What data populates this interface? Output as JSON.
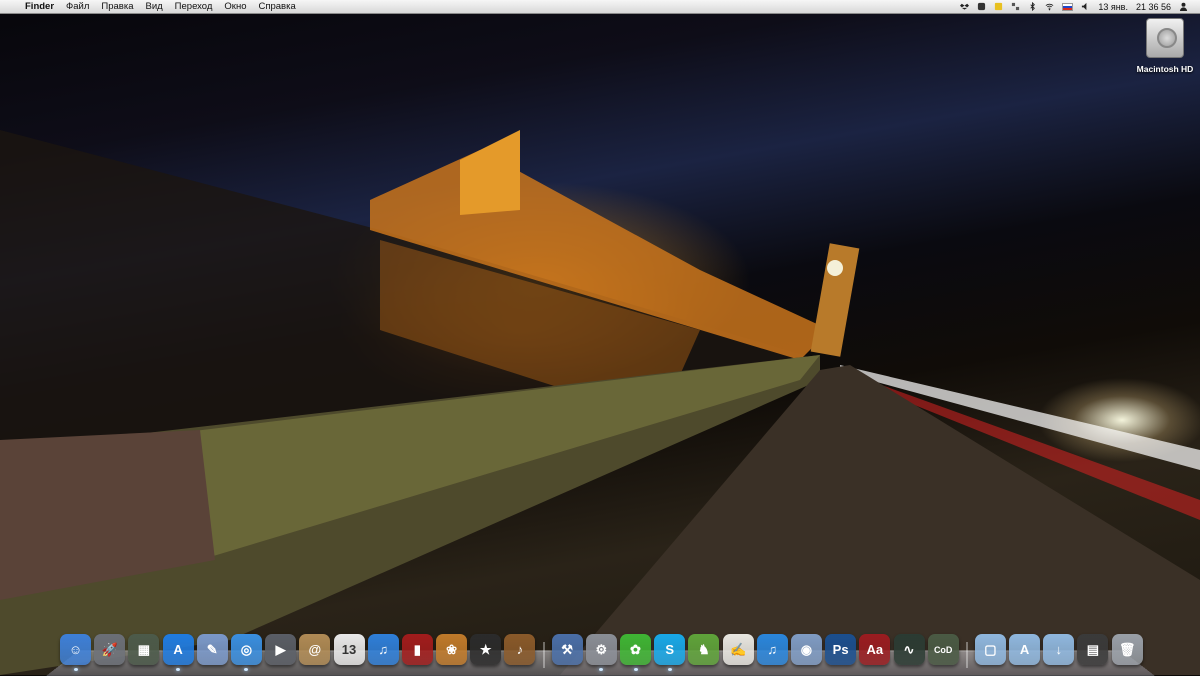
{
  "menubar": {
    "apple_symbol": "",
    "app_name": "Finder",
    "menus": [
      "Файл",
      "Правка",
      "Вид",
      "Переход",
      "Окно",
      "Справка"
    ],
    "status_icons": [
      "dropbox-icon",
      "cloud-icon",
      "note-icon",
      "grid-icon",
      "bluetooth-icon",
      "wifi-icon",
      "flag-ru-icon",
      "volume-icon"
    ],
    "date": "13 янв.",
    "time": "21 36 56",
    "user_icon": "user-icon"
  },
  "desktop": {
    "drive_label": "Macintosh HD"
  },
  "dock": {
    "items": [
      {
        "name": "finder",
        "icon": "finder-icon",
        "glyph": "☺",
        "color": "#3d7fd8",
        "running": true
      },
      {
        "name": "launchpad",
        "icon": "launchpad-icon",
        "glyph": "🚀",
        "color": "#6b6f77",
        "running": false
      },
      {
        "name": "mission-control",
        "icon": "mission-control-icon",
        "glyph": "▦",
        "color": "#4c5a4a",
        "running": false
      },
      {
        "name": "app-store",
        "icon": "app-store-icon",
        "glyph": "A",
        "color": "#1f7be0",
        "running": true
      },
      {
        "name": "preview",
        "icon": "preview-icon",
        "glyph": "✎",
        "color": "#7a98c9",
        "running": false
      },
      {
        "name": "safari",
        "icon": "safari-icon",
        "glyph": "◎",
        "color": "#3a8fe0",
        "running": true
      },
      {
        "name": "facetime",
        "icon": "facetime-icon",
        "glyph": "▶",
        "color": "#5a5e66",
        "running": false
      },
      {
        "name": "address-book",
        "icon": "address-book-icon",
        "glyph": "@",
        "color": "#b08b55",
        "running": false
      },
      {
        "name": "ical",
        "icon": "ical-icon",
        "glyph": "13",
        "color": "#e9e9e9",
        "running": false
      },
      {
        "name": "itunes",
        "icon": "itunes-icon",
        "glyph": "♫",
        "color": "#2f7fd9",
        "running": false
      },
      {
        "name": "photo-booth",
        "icon": "photo-booth-icon",
        "glyph": "▮",
        "color": "#a21c1c",
        "running": false
      },
      {
        "name": "iphoto",
        "icon": "iphoto-icon",
        "glyph": "❀",
        "color": "#c07a2a",
        "running": false
      },
      {
        "name": "imovie",
        "icon": "imovie-icon",
        "glyph": "★",
        "color": "#2b2b2b",
        "running": false
      },
      {
        "name": "garageband",
        "icon": "garageband-icon",
        "glyph": "♪",
        "color": "#8a5a2a",
        "running": false
      },
      {
        "name": "sep1",
        "icon": "separator",
        "glyph": "",
        "color": "",
        "running": false
      },
      {
        "name": "xcode",
        "icon": "xcode-icon",
        "glyph": "⚒",
        "color": "#4a6fa8",
        "running": false
      },
      {
        "name": "system-preferences",
        "icon": "gear-icon",
        "glyph": "⚙",
        "color": "#8a8e96",
        "running": true
      },
      {
        "name": "icq",
        "icon": "icq-icon",
        "glyph": "✿",
        "color": "#3fb534",
        "running": true
      },
      {
        "name": "skype",
        "icon": "skype-icon",
        "glyph": "S",
        "color": "#18a8e8",
        "running": true
      },
      {
        "name": "evernote",
        "icon": "evernote-icon",
        "glyph": "♞",
        "color": "#5fa33a",
        "running": false
      },
      {
        "name": "textedit",
        "icon": "textedit-icon",
        "glyph": "✍",
        "color": "#e8e6e0",
        "running": false
      },
      {
        "name": "itunes-2",
        "icon": "music-icon",
        "glyph": "♫",
        "color": "#2a86dc",
        "running": false
      },
      {
        "name": "image-capture",
        "icon": "image-capture-icon",
        "glyph": "◉",
        "color": "#7f9cc4",
        "running": false
      },
      {
        "name": "photoshop",
        "icon": "photoshop-icon",
        "glyph": "Ps",
        "color": "#1b4f8f",
        "running": false
      },
      {
        "name": "dictionary",
        "icon": "dictionary-icon",
        "glyph": "Aa",
        "color": "#9b1c20",
        "running": false
      },
      {
        "name": "activity-monitor",
        "icon": "activity-monitor-icon",
        "glyph": "∿",
        "color": "#2b3b33",
        "running": false
      },
      {
        "name": "call-of-duty",
        "icon": "game-icon",
        "glyph": "CoD",
        "color": "#4a5a44",
        "running": false
      },
      {
        "name": "sep2",
        "icon": "separator",
        "glyph": "",
        "color": "",
        "running": false
      },
      {
        "name": "applications",
        "icon": "folder-icon",
        "glyph": "▢",
        "color": "#8fb7de",
        "running": false
      },
      {
        "name": "documents",
        "icon": "folder-icon",
        "glyph": "A",
        "color": "#8fb7de",
        "running": false
      },
      {
        "name": "downloads",
        "icon": "folder-icon",
        "glyph": "↓",
        "color": "#8fb7de",
        "running": false
      },
      {
        "name": "stack",
        "icon": "stack-icon",
        "glyph": "▤",
        "color": "#3a3a3a",
        "running": false
      },
      {
        "name": "trash",
        "icon": "trash-icon",
        "glyph": "🗑",
        "color": "#9aa0a8",
        "running": false
      }
    ]
  }
}
